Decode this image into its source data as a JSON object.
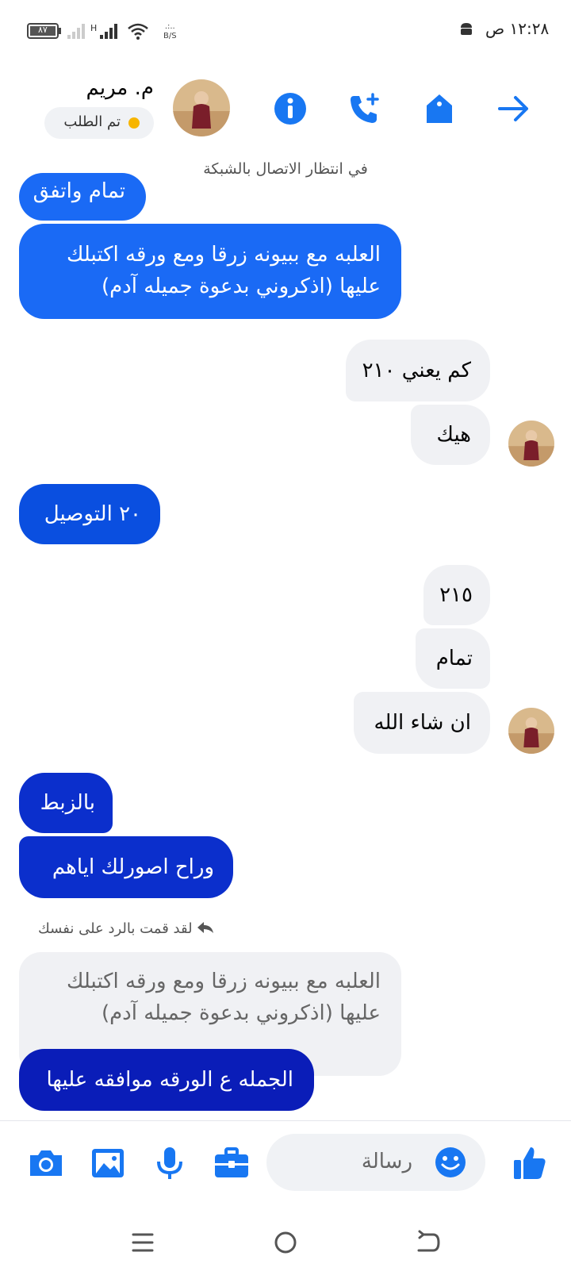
{
  "status_bar": {
    "time": "١٢:٢٨ ص",
    "battery": "٨٧",
    "network_speed_top": ".:..",
    "network_speed_unit": "B/S"
  },
  "header": {
    "contact_name": "م. مريم",
    "order_badge": "تم الطلب",
    "connection_status": "في انتظار الاتصال بالشبكة"
  },
  "colors": {
    "sent_blue_1": "#1a6af5",
    "sent_blue_2": "#0a4fe0",
    "sent_blue_3": "#0b2fcc",
    "sent_blue_4": "#0a1db8",
    "accent": "#1877f2"
  },
  "messages": [
    {
      "side": "sent",
      "text": "تمام واتفق",
      "partial": true
    },
    {
      "side": "sent",
      "line1": "العلبه مع ببيونه زرقا ومع ورقه اكتبلك",
      "line2": "عليها (اذكروني بدعوة  جميله آدم)"
    },
    {
      "side": "received",
      "text": "كم يعني ٢١٠"
    },
    {
      "side": "received",
      "text": "هيك"
    },
    {
      "side": "sent",
      "text": "٢٠ التوصيل"
    },
    {
      "side": "received",
      "text": "٢١٥"
    },
    {
      "side": "received",
      "text": "تمام"
    },
    {
      "side": "received",
      "text": "ان شاء الله"
    },
    {
      "side": "sent",
      "text": "بالزبط"
    },
    {
      "side": "sent",
      "text": "وراح اصورلك اياهم"
    },
    {
      "side": "sent",
      "text": "الجمله ع الورقه موافقه عليها"
    }
  ],
  "reply": {
    "note": "لقد قمت بالرد على نفسك",
    "quoted_line1": "العلبه مع ببيونه زرقا ومع ورقه اكتبلك",
    "quoted_line2": "عليها (اذكروني بدعوة  جميله آدم)"
  },
  "composer": {
    "placeholder": "رسالة"
  }
}
